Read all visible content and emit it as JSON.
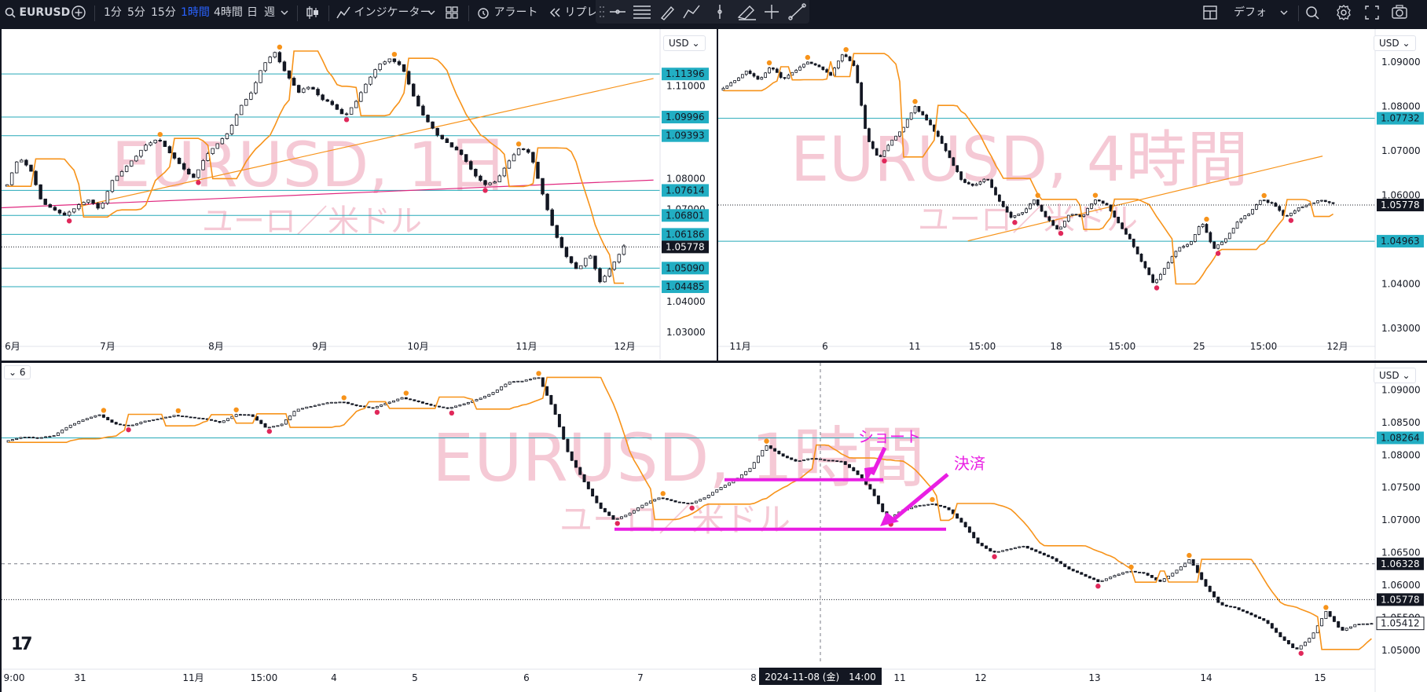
{
  "toolbar": {
    "symbol": "EURUSD",
    "intervals": [
      "1分",
      "5分",
      "15分",
      "1時間",
      "4時間",
      "日",
      "週"
    ],
    "active_interval": "1時間",
    "indicators": "インジケーター",
    "alert": "アラート",
    "replay": "リプレイ",
    "layout": "デフォ"
  },
  "colors": {
    "up": "#ffffff",
    "down": "#131722",
    "trail": "#f7931a",
    "level": "#26a9b8",
    "trend_orange": "#f7931a",
    "trend_pink": "#e0287f",
    "marker_high": "#f7931a",
    "marker_low": "#e0285a",
    "watermark": "#f2b8c8",
    "annotation": "#e91ee3",
    "label_cyan": "#22aec3"
  },
  "panes": [
    {
      "id": "daily",
      "watermark": "EURUSD, 1日",
      "subtitle": "ユーロ／米ドル",
      "currency": "USD",
      "chart_data": {
        "type": "candlestick",
        "interval": "1日",
        "x_ticks": [
          "6月",
          "7月",
          "8月",
          "9月",
          "10月",
          "11月",
          "12月"
        ],
        "y_ticks": [
          "1.11000",
          "1.08000",
          "1.07000",
          "1.04000",
          "1.03000"
        ],
        "ylim": [
          1.027,
          1.126
        ],
        "level_lines": [
          "1.11396",
          "1.09996",
          "1.09393",
          "1.07614",
          "1.06801",
          "1.06186",
          "1.05090",
          "1.04485"
        ],
        "last_price": "1.05778",
        "path": [
          1.078,
          1.087,
          1.083,
          1.072,
          1.07,
          1.068,
          1.071,
          1.073,
          1.07,
          1.079,
          1.083,
          1.087,
          1.091,
          1.093,
          1.088,
          1.084,
          1.08,
          1.087,
          1.091,
          1.095,
          1.103,
          1.108,
          1.117,
          1.121,
          1.114,
          1.108,
          1.11,
          1.106,
          1.104,
          1.1,
          1.105,
          1.112,
          1.117,
          1.119,
          1.116,
          1.106,
          1.099,
          1.094,
          1.091,
          1.088,
          1.082,
          1.078,
          1.079,
          1.085,
          1.09,
          1.088,
          1.075,
          1.063,
          1.055,
          1.05,
          1.056,
          1.046,
          1.052,
          1.058
        ]
      }
    },
    {
      "id": "h4",
      "watermark": "EURUSD, 4時間",
      "subtitle": "ユーロ／米ドル",
      "currency": "USD",
      "chart_data": {
        "type": "candlestick",
        "interval": "4時間",
        "x_ticks": [
          "11月",
          "6",
          "11",
          "15:00",
          "18",
          "15:00",
          "25",
          "15:00",
          "12月"
        ],
        "y_ticks": [
          "1.09000",
          "1.08000",
          "1.07000",
          "1.06000",
          "1.04000",
          "1.03000"
        ],
        "ylim": [
          1.027,
          1.096
        ],
        "level_lines": [
          "1.07732",
          "1.04963"
        ],
        "last_price": "1.05778",
        "path": [
          1.084,
          1.086,
          1.088,
          1.086,
          1.089,
          1.086,
          1.088,
          1.09,
          1.089,
          1.087,
          1.092,
          1.089,
          1.073,
          1.068,
          1.072,
          1.075,
          1.08,
          1.077,
          1.073,
          1.068,
          1.063,
          1.062,
          1.064,
          1.059,
          1.055,
          1.056,
          1.059,
          1.055,
          1.052,
          1.056,
          1.055,
          1.059,
          1.058,
          1.054,
          1.05,
          1.045,
          1.04,
          1.044,
          1.048,
          1.049,
          1.054,
          1.048,
          1.05,
          1.054,
          1.056,
          1.059,
          1.058,
          1.055,
          1.057,
          1.058,
          1.059,
          1.058
        ]
      }
    },
    {
      "id": "h1",
      "watermark": "EURUSD, 1時間",
      "subtitle": "ユーロ／米ドル",
      "currency": "USD",
      "layout_indicator": "6",
      "chart_data": {
        "type": "candlestick",
        "interval": "1時間",
        "x_ticks": [
          "9:00",
          "31",
          "11月",
          "15:00",
          "4",
          "5",
          "6",
          "7",
          "8",
          "11",
          "12",
          "13",
          "14",
          "15"
        ],
        "y_ticks": [
          "1.09000",
          "1.08500",
          "1.08000",
          "1.07500",
          "1.07000",
          "1.06500",
          "1.06000",
          "1.05500",
          "1.05000"
        ],
        "ylim": [
          1.0478,
          1.0932
        ],
        "level_lines": [
          "1.08264"
        ],
        "crosshair_price": "1.06328",
        "last_price": "1.05778",
        "last_close": "1.05412",
        "crosshair_time": "2024-11-08 (金)　14:00",
        "short_entry_price": 1.0762,
        "exit_price": 1.0686,
        "annotations": [
          "ショート",
          "決済"
        ],
        "path": [
          1.0822,
          1.0828,
          1.0826,
          1.083,
          1.0845,
          1.0855,
          1.0862,
          1.0848,
          1.0845,
          1.0852,
          1.0856,
          1.0861,
          1.0858,
          1.0855,
          1.085,
          1.0862,
          1.0862,
          1.0842,
          1.0846,
          1.087,
          1.0875,
          1.088,
          1.0882,
          1.0876,
          1.0872,
          1.088,
          1.0888,
          1.0882,
          1.0876,
          1.0872,
          1.0878,
          1.0886,
          1.0896,
          1.0912,
          1.0914,
          1.092,
          1.087,
          1.08,
          1.076,
          1.072,
          1.07,
          1.071,
          1.0725,
          1.0735,
          1.0728,
          1.0725,
          1.0735,
          1.075,
          1.0762,
          1.078,
          1.0815,
          1.08,
          1.079,
          1.0795,
          1.0792,
          1.079,
          1.0772,
          1.0745,
          1.07,
          1.0715,
          1.0722,
          1.0725,
          1.0718,
          1.0695,
          1.0665,
          1.065,
          1.0655,
          1.066,
          1.065,
          1.064,
          1.0625,
          1.0615,
          1.0605,
          1.0615,
          1.0622,
          1.0618,
          1.0605,
          1.062,
          1.064,
          1.06,
          1.057,
          1.0565,
          1.0555,
          1.0545,
          1.052,
          1.05,
          1.052,
          1.056,
          1.053,
          1.054,
          1.0541
        ]
      }
    }
  ]
}
